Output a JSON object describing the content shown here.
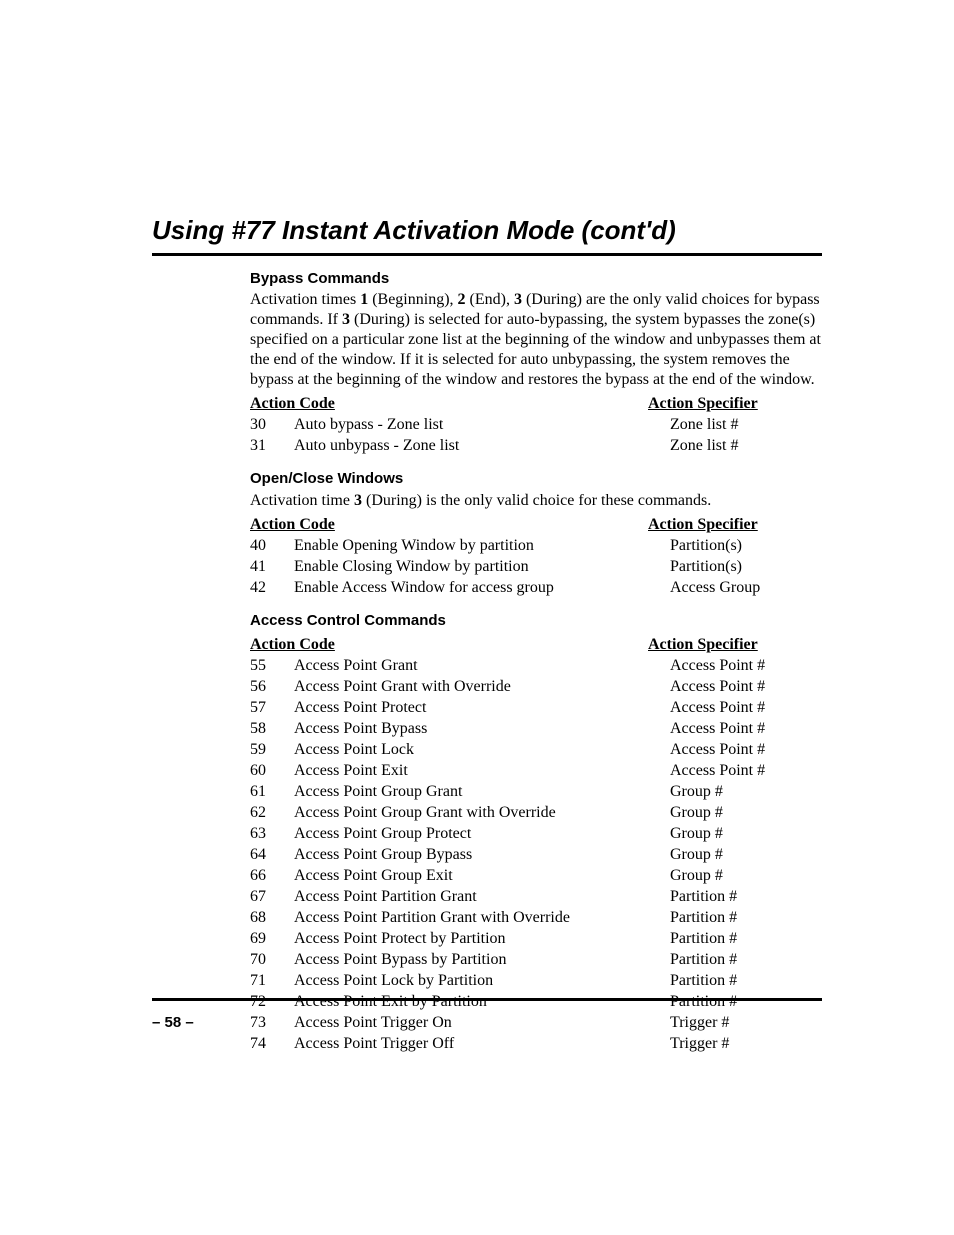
{
  "title": "Using #77 Instant Activation Mode (cont'd)",
  "page_number": "– 58 –",
  "col_action_code": "Action Code",
  "col_action_specifier": "Action Specifier",
  "bypass": {
    "heading": "Bypass Commands",
    "para_before": "Activation times ",
    "b1": "1",
    "t1": " (Beginning), ",
    "b2": "2",
    "t2": " (End), ",
    "b3": "3",
    "t3": " (During) are the only valid choices for bypass commands.  If ",
    "b4": "3",
    "t4": " (During) is selected for auto-bypassing, the system bypasses the zone(s) specified on a particular zone list at the beginning of the window and unbypasses them at the end of the window.  If it is selected for auto unbypassing, the system removes the bypass at the beginning of the window and restores the bypass at the end of the window.",
    "rows": [
      {
        "code": "30",
        "desc": "Auto bypass - Zone list",
        "spec": "Zone list #"
      },
      {
        "code": "31",
        "desc": "Auto unbypass - Zone list",
        "spec": "Zone list #"
      }
    ]
  },
  "openclose": {
    "heading": "Open/Close Windows",
    "para_before": "Activation time ",
    "b1": "3",
    "t1": " (During) is the only valid choice for these commands.",
    "rows": [
      {
        "code": "40",
        "desc": "Enable Opening Window by partition",
        "spec": "Partition(s)"
      },
      {
        "code": "41",
        "desc": "Enable Closing Window by partition",
        "spec": "Partition(s)"
      },
      {
        "code": "42",
        "desc": "Enable Access Window for access group",
        "spec": "Access Group"
      }
    ]
  },
  "access": {
    "heading": "Access Control Commands",
    "rows": [
      {
        "code": "55",
        "desc": "Access Point Grant",
        "spec": "Access Point #"
      },
      {
        "code": "56",
        "desc": "Access Point Grant with Override",
        "spec": "Access Point #"
      },
      {
        "code": "57",
        "desc": "Access Point Protect",
        "spec": "Access Point #"
      },
      {
        "code": "58",
        "desc": "Access Point Bypass",
        "spec": "Access Point #"
      },
      {
        "code": "59",
        "desc": "Access Point Lock",
        "spec": "Access Point #"
      },
      {
        "code": "60",
        "desc": "Access Point Exit",
        "spec": "Access Point #"
      },
      {
        "code": "61",
        "desc": "Access Point Group Grant",
        "spec": "Group #"
      },
      {
        "code": "62",
        "desc": "Access Point Group Grant with Override",
        "spec": "Group #"
      },
      {
        "code": "63",
        "desc": "Access Point Group Protect",
        "spec": "Group #"
      },
      {
        "code": "64",
        "desc": "Access Point Group Bypass",
        "spec": "Group #"
      },
      {
        "code": "66",
        "desc": "Access Point Group Exit",
        "spec": "Group #"
      },
      {
        "code": "67",
        "desc": "Access Point Partition Grant",
        "spec": "Partition #"
      },
      {
        "code": "68",
        "desc": "Access Point Partition Grant with Override",
        "spec": "Partition #"
      },
      {
        "code": "69",
        "desc": "Access Point Protect by Partition",
        "spec": "Partition #"
      },
      {
        "code": "70",
        "desc": "Access Point Bypass by Partition",
        "spec": "Partition #"
      },
      {
        "code": "71",
        "desc": "Access Point Lock by Partition",
        "spec": "Partition #"
      },
      {
        "code": "72",
        "desc": "Access Point Exit by Partition",
        "spec": "Partition #"
      },
      {
        "code": "73",
        "desc": "Access Point Trigger On",
        "spec": "Trigger #"
      },
      {
        "code": "74",
        "desc": "Access Point Trigger Off",
        "spec": "Trigger #"
      }
    ]
  }
}
